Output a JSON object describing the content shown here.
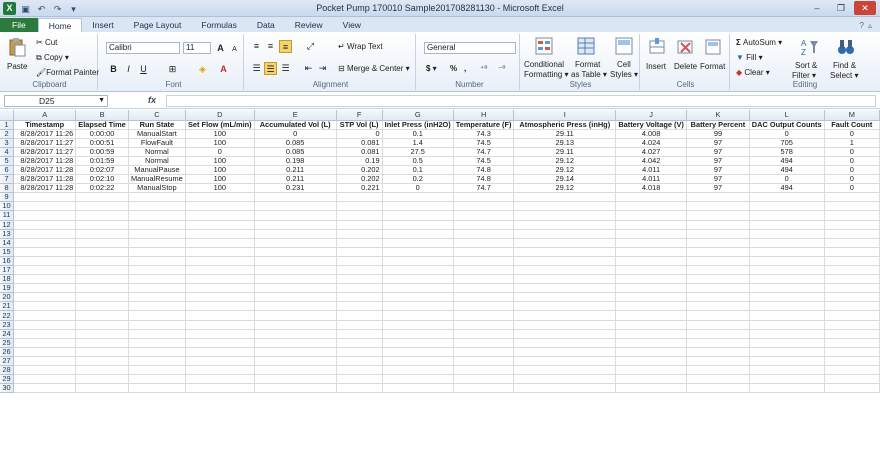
{
  "window": {
    "title": "Pocket Pump 170010 Sample201708281130  -  Microsoft Excel",
    "app_icon": "excel-icon",
    "controls": {
      "minimize": "–",
      "maximize": "❐",
      "close": "✕"
    }
  },
  "ribbon_tabs": [
    "File",
    "Home",
    "Insert",
    "Page Layout",
    "Formulas",
    "Data",
    "Review",
    "View"
  ],
  "active_tab": "Home",
  "ribbon": {
    "clipboard": {
      "label": "Clipboard",
      "paste": "Paste",
      "cut": "Cut",
      "copy": "Copy ▾",
      "format_painter": "Format Painter"
    },
    "font": {
      "label": "Font",
      "name": "Calibri",
      "size": "11",
      "grow": "A",
      "shrink": "A",
      "bold": "B",
      "italic": "I",
      "underline": "U"
    },
    "alignment": {
      "label": "Alignment",
      "wrap_text": "Wrap Text",
      "merge_center": "Merge & Center ▾"
    },
    "number": {
      "label": "Number",
      "format": "General",
      "currency": "$ ▾",
      "percent": "%",
      "comma": ","
    },
    "styles": {
      "label": "Styles",
      "conditional": "Conditional",
      "conditional2": "Formatting ▾",
      "format_table": "Format",
      "format_table2": "as Table ▾",
      "cell_styles": "Cell",
      "cell_styles2": "Styles ▾"
    },
    "cells": {
      "label": "Cells",
      "insert": "Insert",
      "delete": "Delete",
      "format": "Format"
    },
    "editing": {
      "label": "Editing",
      "autosum": "AutoSum ▾",
      "fill": "Fill ▾",
      "clear": "Clear ▾",
      "sort": "Sort &",
      "sort2": "Filter ▾",
      "find": "Find &",
      "find2": "Select ▾"
    }
  },
  "formula_bar": {
    "name_box": "D25",
    "fx": "fx",
    "value": ""
  },
  "sheet": {
    "columns": [
      "A",
      "B",
      "C",
      "D",
      "E",
      "F",
      "G",
      "H",
      "I",
      "J",
      "K",
      "L",
      "M"
    ],
    "row_count": 30,
    "headers": [
      "Timestamp",
      "Elapsed Time",
      "Run State",
      "Set Flow (mL/min)",
      "Accumulated Vol (L)",
      "STP Vol (L)",
      "Inlet Press (inH2O)",
      "Temperature (F)",
      "Atmospheric Press (inHg)",
      "Battery Voltage (V)",
      "Battery Percent",
      "DAC Output Counts",
      "Fault Count"
    ],
    "rows": [
      [
        "8/28/2017 11:26",
        "0:00:00",
        "ManualStart",
        "100",
        "0",
        "0",
        "0.1",
        "74.3",
        "29.11",
        "4.008",
        "99",
        "0",
        "0"
      ],
      [
        "8/28/2017 11:27",
        "0:00:51",
        "FlowFault",
        "100",
        "0.085",
        "0.081",
        "1.4",
        "74.5",
        "29.13",
        "4.024",
        "97",
        "705",
        "1"
      ],
      [
        "8/28/2017 11:27",
        "0:00:59",
        "Normal",
        "0",
        "0.085",
        "0.081",
        "27.5",
        "74.7",
        "29.11",
        "4.027",
        "97",
        "578",
        "0"
      ],
      [
        "8/28/2017 11:28",
        "0:01:59",
        "Normal",
        "100",
        "0.198",
        "0.19",
        "0.5",
        "74.5",
        "29.12",
        "4.042",
        "97",
        "494",
        "0"
      ],
      [
        "8/28/2017 11:28",
        "0:02:07",
        "ManualPause",
        "100",
        "0.211",
        "0.202",
        "0.1",
        "74.8",
        "29.12",
        "4.011",
        "97",
        "494",
        "0"
      ],
      [
        "8/28/2017 11:28",
        "0:02:10",
        "ManualResume",
        "100",
        "0.211",
        "0.202",
        "0.2",
        "74.8",
        "29.14",
        "4.011",
        "97",
        "0",
        "0"
      ],
      [
        "8/28/2017 11:28",
        "0:02:22",
        "ManualStop",
        "100",
        "0.231",
        "0.221",
        "0",
        "74.7",
        "29.12",
        "4.018",
        "97",
        "494",
        "0"
      ]
    ]
  },
  "colors": {
    "file_tab": "#2c7a3d",
    "ribbon_bg": "#e8eff8",
    "header_bg": "#e2e9f3"
  }
}
